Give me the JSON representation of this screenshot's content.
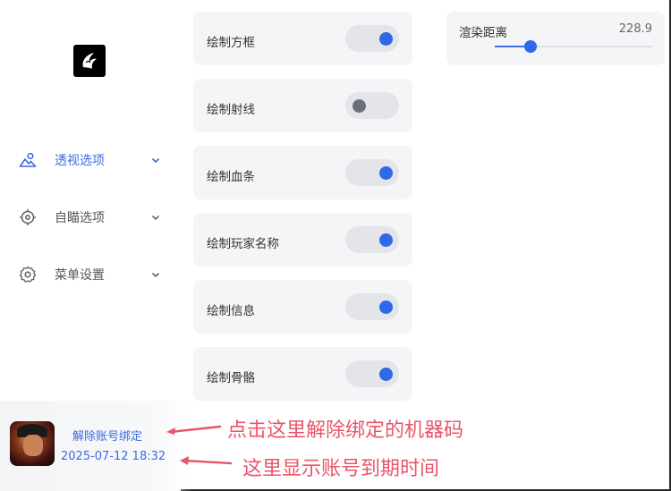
{
  "sidebar": {
    "nav": [
      {
        "label": "透视选项",
        "icon": "landscape-icon",
        "active": true
      },
      {
        "label": "自瞄选项",
        "icon": "crosshair-icon",
        "active": false
      },
      {
        "label": "菜单设置",
        "icon": "gear-icon",
        "active": false
      }
    ],
    "account": {
      "unbind_label": "解除账号绑定",
      "expire_time": "2025-07-12 18:32"
    }
  },
  "options": [
    {
      "label": "绘制方框",
      "on": true
    },
    {
      "label": "绘制射线",
      "on": false
    },
    {
      "label": "绘制血条",
      "on": true
    },
    {
      "label": "绘制玩家名称",
      "on": true
    },
    {
      "label": "绘制信息",
      "on": true
    },
    {
      "label": "绘制骨骼",
      "on": true
    }
  ],
  "render_distance": {
    "label": "渲染距离",
    "value": "228.9",
    "fraction": 0.23
  },
  "annotations": {
    "unbind_note": "点击这里解除绑定的机器码",
    "expire_note": "这里显示账号到期时间"
  },
  "colors": {
    "accent": "#2f68e8",
    "annotation": "#e8556a"
  }
}
